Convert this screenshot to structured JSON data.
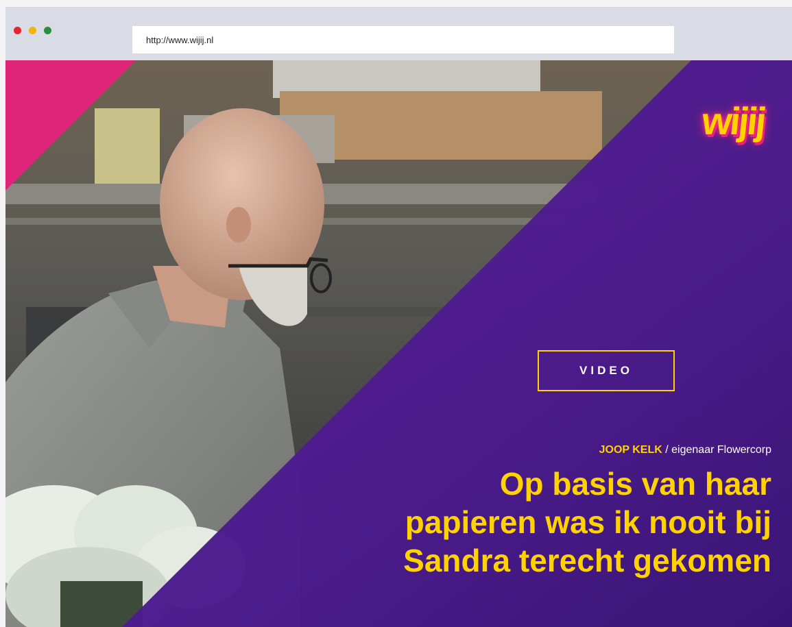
{
  "browser": {
    "url": "http://www.wijij.nl"
  },
  "brand": {
    "logo_text": "wijij"
  },
  "hero": {
    "video_label": "VIDEO",
    "byline_name": "JOOP KELK",
    "byline_separator": " / ",
    "byline_role": "eigenaar Flowercorp",
    "headline_lines": [
      "Op basis van haar",
      "papieren was ik nooit bij",
      "Sandra terecht gekomen"
    ]
  },
  "colors": {
    "accent_yellow": "#ffd200",
    "overlay_purple": "#4b1a8c",
    "corner_magenta": "#e0247a"
  }
}
